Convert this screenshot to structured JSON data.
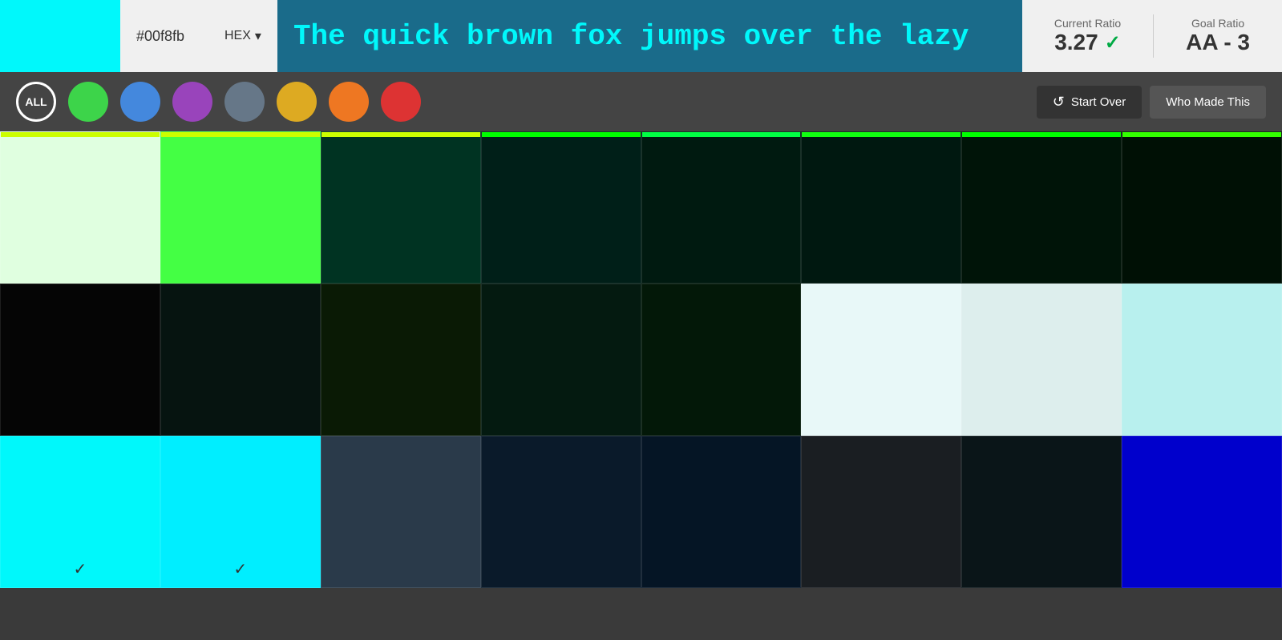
{
  "header": {
    "swatch_color": "#00f8fb",
    "hex_value": "#00f8fb",
    "hex_format": "HEX",
    "preview_text": "The quick brown fox jumps over the lazy",
    "preview_bg": "#1a6b8a",
    "preview_text_color": "#00f8fb",
    "current_ratio_label": "Current Ratio",
    "current_ratio_value": "3.27",
    "current_ratio_check": "✓",
    "goal_ratio_label": "Goal Ratio",
    "goal_ratio_value": "AA - 3"
  },
  "filter_bar": {
    "all_label": "ALL",
    "dots": [
      {
        "color": "#3dd44a",
        "name": "green"
      },
      {
        "color": "#4488dd",
        "name": "blue"
      },
      {
        "color": "#9944bb",
        "name": "purple"
      },
      {
        "color": "#667788",
        "name": "gray"
      },
      {
        "color": "#ddaa22",
        "name": "yellow"
      },
      {
        "color": "#ee7722",
        "name": "orange"
      },
      {
        "color": "#dd3333",
        "name": "red"
      }
    ],
    "start_over_label": "Start Over",
    "who_made_label": "Who Made This"
  },
  "grid": {
    "rows": [
      [
        {
          "bg": "#e0ffe0",
          "strip": "#ccff00",
          "selected": false
        },
        {
          "bg": "#44ff44",
          "strip": "#ccff00",
          "selected": false
        },
        {
          "bg": "#003322",
          "strip": "#ccff00",
          "selected": false
        },
        {
          "bg": "#001f18",
          "strip": "#00ff00",
          "selected": false
        },
        {
          "bg": "#001a10",
          "strip": "#00ff44",
          "selected": false
        },
        {
          "bg": "#001810",
          "strip": "#11ff11",
          "selected": false
        },
        {
          "bg": "#001408",
          "strip": "#00ff00",
          "selected": false
        },
        {
          "bg": "#001005",
          "strip": "#33ff00",
          "selected": false
        }
      ],
      [
        {
          "bg": "#050505",
          "strip": "transparent",
          "selected": false
        },
        {
          "bg": "#061410",
          "strip": "transparent",
          "selected": false
        },
        {
          "bg": "#0a1a05",
          "strip": "transparent",
          "selected": false
        },
        {
          "bg": "#041a10",
          "strip": "transparent",
          "selected": false
        },
        {
          "bg": "#031808",
          "strip": "transparent",
          "selected": false
        },
        {
          "bg": "#e8f8f8",
          "strip": "transparent",
          "selected": false
        },
        {
          "bg": "#ddeeed",
          "strip": "transparent",
          "selected": false
        },
        {
          "bg": "#b8f0ee",
          "strip": "transparent",
          "selected": false
        }
      ],
      [
        {
          "bg": "#00f8fb",
          "strip": "transparent",
          "selected": true
        },
        {
          "bg": "#00eeff",
          "strip": "transparent",
          "selected": true
        },
        {
          "bg": "#2a3a4a",
          "strip": "transparent",
          "selected": false
        },
        {
          "bg": "#0a1a2a",
          "strip": "transparent",
          "selected": false
        },
        {
          "bg": "#051525",
          "strip": "transparent",
          "selected": false
        },
        {
          "bg": "#1a1e22",
          "strip": "transparent",
          "selected": false
        },
        {
          "bg": "#0a1518",
          "strip": "transparent",
          "selected": false
        },
        {
          "bg": "#0000cc",
          "strip": "transparent",
          "selected": false
        }
      ]
    ]
  }
}
